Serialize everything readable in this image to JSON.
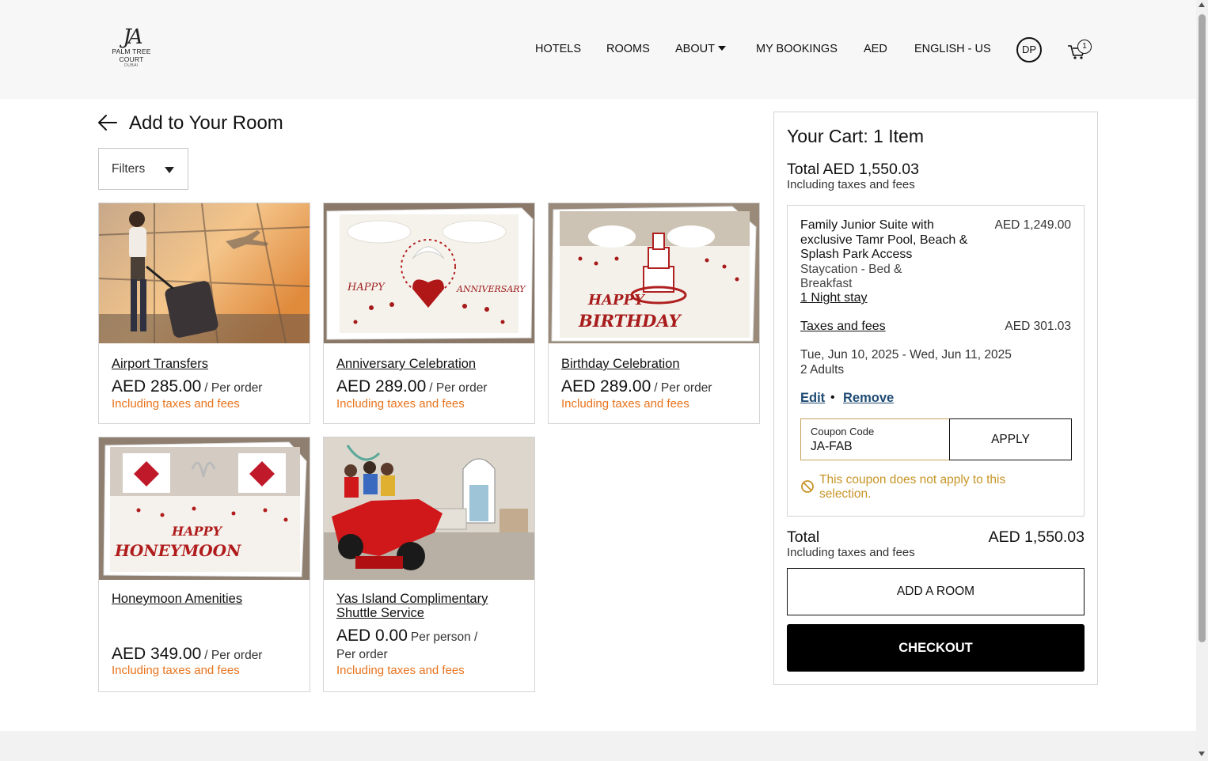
{
  "header": {
    "logo": {
      "mark": "JA",
      "line1": "PALM TREE",
      "line2": "COURT",
      "line3": "DUBAI"
    },
    "nav": [
      "HOTELS",
      "ROOMS",
      "ABOUT",
      "MY BOOKINGS",
      "AED",
      "ENGLISH - US"
    ],
    "avatar_initials": "DP",
    "cart_count": "1"
  },
  "page": {
    "title": "Add to Your Room",
    "filters_label": "Filters"
  },
  "products": [
    {
      "name": "Airport Transfers",
      "price": "AED 285.00",
      "unit": "/ Per order",
      "unit2": "",
      "tax_note": "Including taxes and fees",
      "image": "airport-traveler-image"
    },
    {
      "name": "Anniversary Celebration",
      "price": "AED 289.00",
      "unit": "/ Per order",
      "unit2": "",
      "tax_note": "Including taxes and fees",
      "image": "anniversary-bed-image"
    },
    {
      "name": "Birthday Celebration",
      "price": "AED 289.00",
      "unit": "/ Per order",
      "unit2": "",
      "tax_note": "Including taxes and fees",
      "image": "birthday-bed-image"
    },
    {
      "name": "Honeymoon Amenities",
      "price": "AED 349.00",
      "unit": "/ Per order",
      "unit2": "",
      "tax_note": "Including taxes and fees",
      "image": "honeymoon-bed-image"
    },
    {
      "name": "Yas Island Complimentary Shuttle Service",
      "name_line1": "Yas Island Complimentary",
      "name_line2": "Shuttle Service",
      "price": "AED 0.00",
      "unit": "Per person /",
      "unit2": "Per order",
      "tax_note": "Including taxes and fees",
      "image": "yas-island-ride-image"
    }
  ],
  "cart": {
    "title": "Your Cart: 1 Item",
    "total_top": "Total AED 1,550.03",
    "incl_top": "Including taxes and fees",
    "item": {
      "room_name": "Family Junior Suite with exclusive Tamr Pool, Beach & Splash Park Access",
      "room_price": "AED 1,249.00",
      "rate_name": "Staycation - Bed & Breakfast",
      "stay": "1 Night stay",
      "taxes_label": "Taxes and fees",
      "taxes_value": "AED 301.03",
      "dates": "Tue, Jun 10, 2025 - Wed, Jun 11, 2025",
      "guests": "2 Adults",
      "edit": "Edit",
      "separator": "•",
      "remove": "Remove"
    },
    "coupon": {
      "label": "Coupon Code",
      "value": "JA-FAB",
      "apply": "APPLY",
      "error": "This coupon does not apply to this selection."
    },
    "total_label": "Total",
    "total_value": "AED 1,550.03",
    "incl_bottom": "Including taxes and fees",
    "add_room": "ADD A ROOM",
    "checkout": "CHECKOUT"
  },
  "colors": {
    "accent_orange": "#e8731c",
    "link_blue": "#1f4b73",
    "warning_gold": "#c79528",
    "header_bg": "#f7f7f7"
  }
}
